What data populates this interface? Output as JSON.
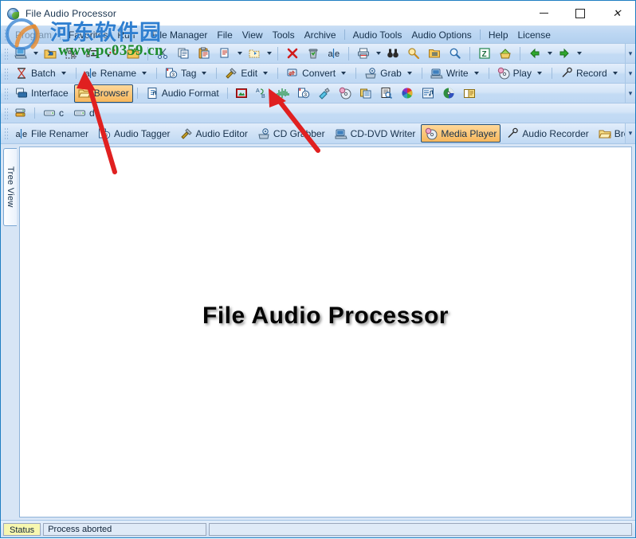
{
  "window": {
    "title": "File Audio Processor",
    "icon": "app-disc-icon",
    "controls": {
      "minimize": "—",
      "maximize": "□",
      "close": "✕"
    }
  },
  "menu": {
    "items": [
      {
        "label": "Program",
        "dim": true
      },
      {
        "label": "Favorites"
      },
      {
        "label": "Run"
      },
      {
        "label": "File Manager"
      },
      {
        "label": "File"
      },
      {
        "label": "View"
      },
      {
        "label": "Tools"
      },
      {
        "label": "Archive"
      },
      {
        "label": "Audio Tools"
      },
      {
        "label": "Audio Options"
      },
      {
        "label": "Help"
      },
      {
        "label": "License"
      }
    ]
  },
  "toolbar_main": {
    "items": [
      {
        "icon": "computer-open-icon",
        "caret": true
      },
      {
        "icon": "folder-enter-icon"
      },
      {
        "icon": "select-all-icon"
      },
      {
        "icon": "select-list-icon"
      },
      {
        "icon": "select-invert-icon"
      },
      {
        "icon": "new-folder-icon"
      },
      {
        "icon": "cut-scissors-icon"
      },
      {
        "icon": "copy-icon"
      },
      {
        "icon": "paste-clipboard-icon"
      },
      {
        "icon": "paste-special-icon",
        "caret": true
      },
      {
        "icon": "move-folder-icon",
        "caret": true
      },
      {
        "icon": "delete-x-icon"
      },
      {
        "icon": "recycle-bin-icon"
      },
      {
        "icon": "rename-ale-icon"
      },
      {
        "icon": "print-icon",
        "caret": true
      },
      {
        "icon": "find-binoculars-icon"
      },
      {
        "icon": "zoom-search-icon"
      },
      {
        "icon": "properties-folder-icon"
      },
      {
        "icon": "magnifier-icon"
      },
      {
        "icon": "zip-icon"
      },
      {
        "icon": "unpack-icon"
      },
      {
        "icon": "back-arrow-icon",
        "caret": true
      },
      {
        "icon": "forward-arrow-icon",
        "caret": true
      }
    ]
  },
  "toolbar_modules": {
    "items": [
      {
        "label": "Batch",
        "icon": "batch-icon",
        "caret": true
      },
      {
        "label": "Rename",
        "icon": "rename-ale-icon",
        "caret": true
      },
      {
        "label": "Tag",
        "icon": "tag-id3-icon",
        "caret": true
      },
      {
        "label": "Edit",
        "icon": "edit-tools-icon",
        "caret": true
      },
      {
        "label": "Convert",
        "icon": "convert-icon",
        "caret": true
      },
      {
        "label": "Grab",
        "icon": "grab-icon",
        "caret": true
      },
      {
        "label": "Write",
        "icon": "write-icon",
        "caret": true
      },
      {
        "label": "Play",
        "icon": "play-disc-icon",
        "caret": true
      },
      {
        "label": "Record",
        "icon": "record-mic-icon",
        "caret": true
      }
    ]
  },
  "toolbar_view": {
    "buttons": [
      {
        "label": "Interface",
        "icon": "interface-icon",
        "active": false
      },
      {
        "label": "Browser",
        "icon": "browser-folder-icon",
        "active": true
      },
      {
        "label": "Audio Format",
        "icon": "audio-format-icon",
        "active": false
      }
    ],
    "icons": [
      {
        "icon": "image-preview-icon"
      },
      {
        "icon": "convert-ab-icon"
      },
      {
        "icon": "waveform-icon"
      },
      {
        "icon": "id3-info-icon"
      },
      {
        "icon": "clean-audio-icon"
      },
      {
        "icon": "cd-play-icon"
      },
      {
        "icon": "copy-files-icon"
      },
      {
        "icon": "inspect-doc-icon"
      },
      {
        "icon": "color-wheel-icon"
      },
      {
        "icon": "playlist-icon"
      },
      {
        "icon": "disc-burn-icon"
      },
      {
        "icon": "book-icon"
      }
    ]
  },
  "toolbar_drives": {
    "items": [
      {
        "icon": "drives-icon",
        "label": ""
      },
      {
        "icon": "drive-icon",
        "label": "c"
      },
      {
        "icon": "drive-icon",
        "label": "d"
      }
    ]
  },
  "module_tabs": {
    "items": [
      {
        "label": "File Renamer",
        "icon": "rename-ale-icon",
        "active": false
      },
      {
        "label": "Audio Tagger",
        "icon": "tag-id3-icon",
        "active": false
      },
      {
        "label": "Audio Editor",
        "icon": "edit-tools-icon",
        "active": false
      },
      {
        "label": "CD Grabber",
        "icon": "grab-icon",
        "active": false
      },
      {
        "label": "CD-DVD Writer",
        "icon": "write-icon",
        "active": false
      },
      {
        "label": "Media Player",
        "icon": "play-disc-icon",
        "active": true
      },
      {
        "label": "Audio Recorder",
        "icon": "record-mic-icon",
        "active": false
      },
      {
        "label": "Browser",
        "icon": "browser-folder-icon",
        "active": false
      }
    ]
  },
  "sidebar": {
    "treeview_label": "Tree View"
  },
  "main": {
    "brand_text": "File Audio Processor"
  },
  "statusbar": {
    "label": "Status",
    "message": "Process aborted",
    "secondary": ""
  },
  "watermark": {
    "site_cn": "河东软件园",
    "site_url": "www.pc0359.cn"
  },
  "colors": {
    "accent_blue": "#1f7ec2",
    "toolbar_blue": "#c3dbf4",
    "active_orange": "#f7b75c",
    "status_yellow": "#f7f7b0",
    "annotation_red": "#e02020"
  }
}
